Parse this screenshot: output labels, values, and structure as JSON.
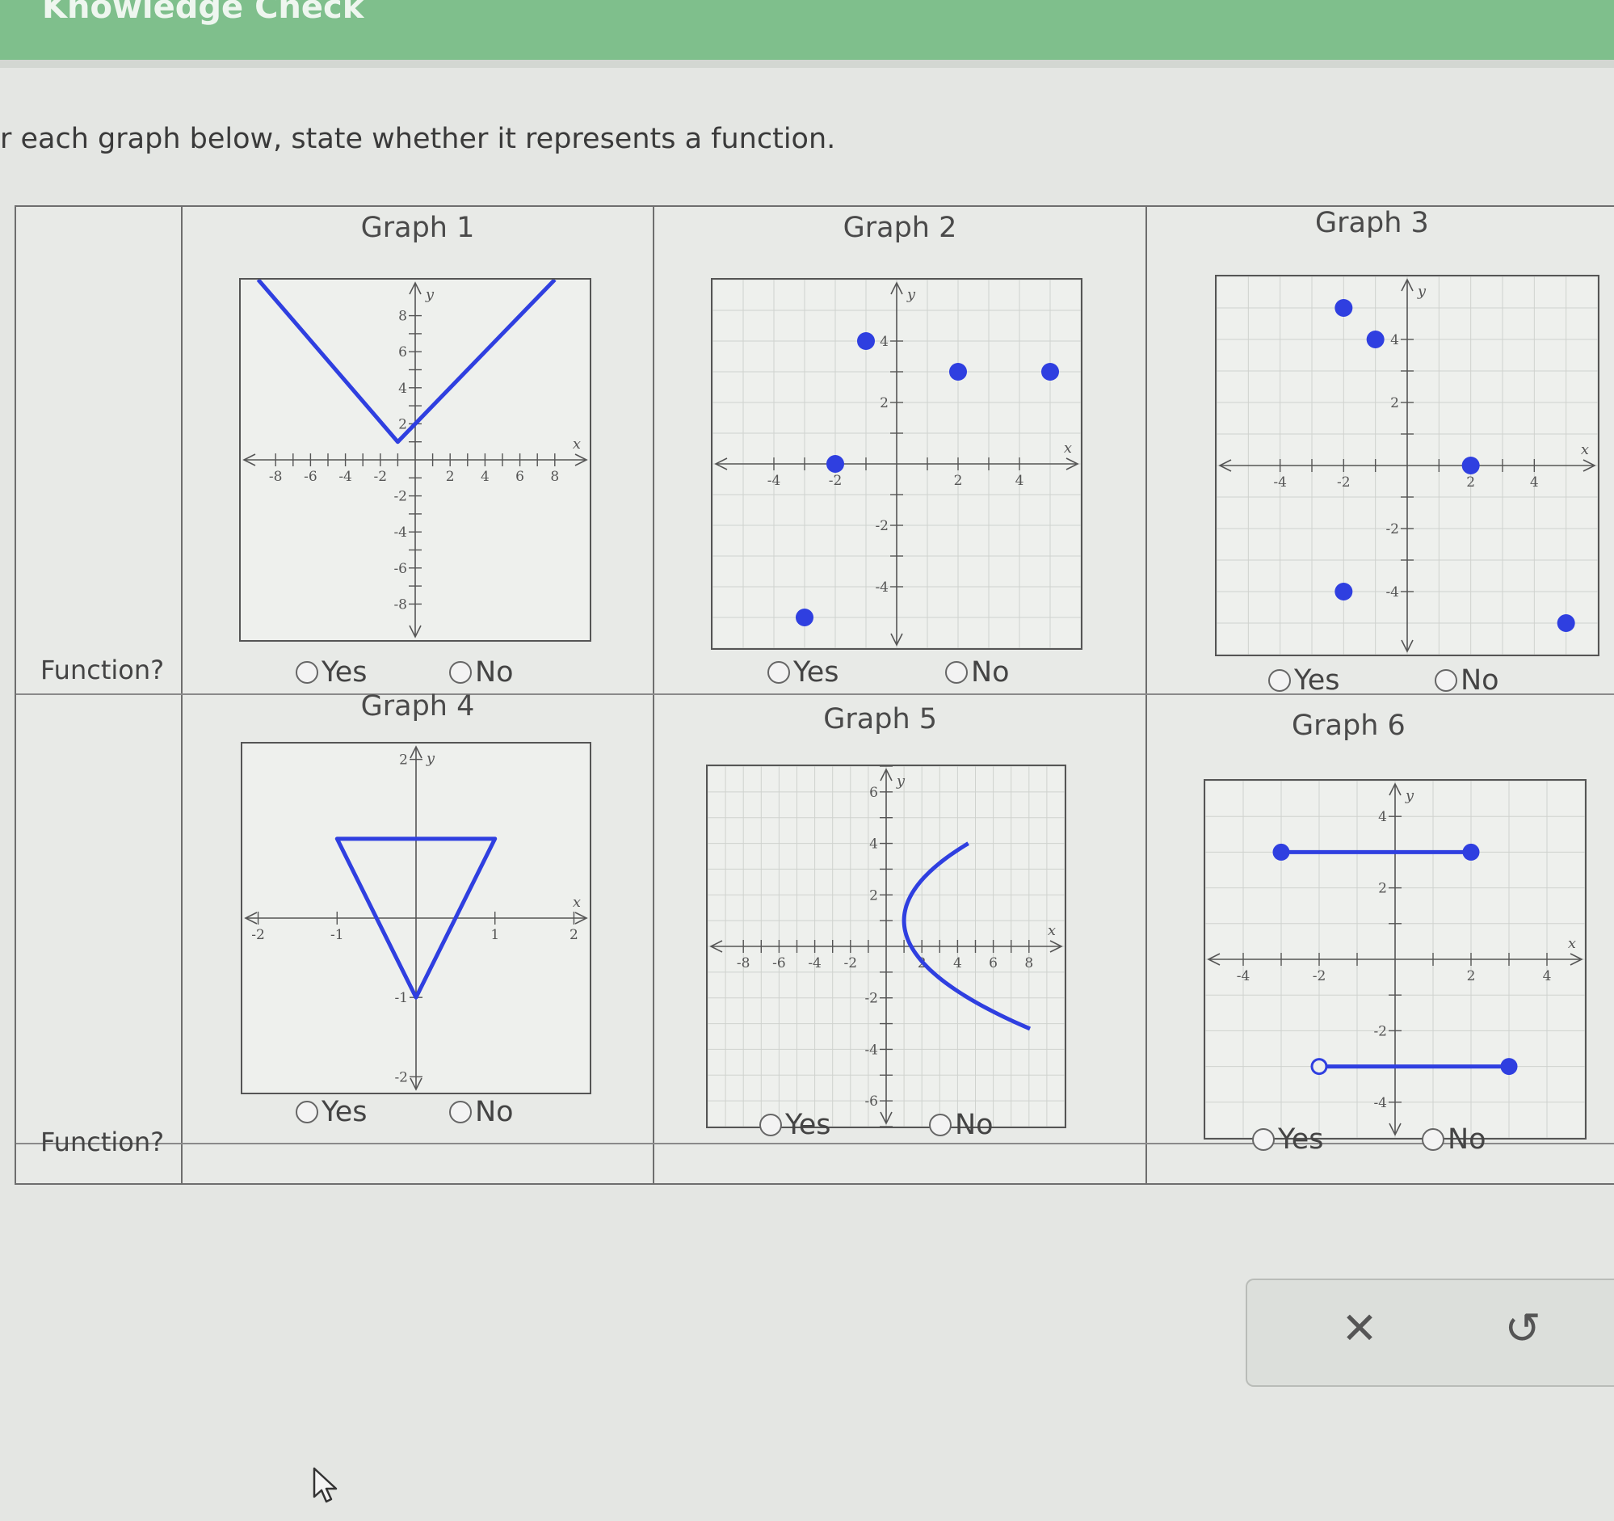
{
  "header": {
    "title": "Knowledge Check"
  },
  "instruction": "r each graph below, state whether it represents a function.",
  "row_label": "Function?",
  "options": {
    "yes": "Yes",
    "no": "No"
  },
  "graphs": [
    {
      "title": "Graph 1",
      "xlim": [
        -10,
        10
      ],
      "ylim": [
        -10,
        10
      ],
      "xticks": [
        -8,
        -6,
        -4,
        -2,
        2,
        4,
        6,
        8
      ],
      "yticks": [
        -8,
        -6,
        -4,
        -2,
        2,
        4,
        6,
        8
      ],
      "tick_marks": [
        -8,
        -7,
        -6,
        -5,
        -4,
        -3,
        -2,
        -1,
        1,
        2,
        3,
        4,
        5,
        6,
        7,
        8
      ],
      "grid": false,
      "shape": {
        "kind": "polyline",
        "points": [
          [
            -9,
            10
          ],
          [
            -1,
            1
          ],
          [
            8,
            10
          ]
        ]
      }
    },
    {
      "title": "Graph 2",
      "xlim": [
        -6,
        6
      ],
      "ylim": [
        -6,
        6
      ],
      "xticks": [
        -4,
        -2,
        2,
        4
      ],
      "yticks": [
        -4,
        -2,
        2,
        4
      ],
      "tick_marks": [
        -4,
        -3,
        -2,
        -1,
        1,
        2,
        3,
        4
      ],
      "grid": true,
      "shape": {
        "kind": "points",
        "points": [
          [
            -2,
            0
          ],
          [
            -1,
            4
          ],
          [
            2,
            3
          ],
          [
            5,
            3
          ],
          [
            -3,
            -5
          ]
        ]
      }
    },
    {
      "title": "Graph 3",
      "xlim": [
        -6,
        6
      ],
      "ylim": [
        -6,
        6
      ],
      "xticks": [
        -4,
        -2,
        2,
        4
      ],
      "yticks": [
        -4,
        -2,
        2,
        4
      ],
      "tick_marks": [
        -4,
        -3,
        -2,
        -1,
        1,
        2,
        3,
        4
      ],
      "grid": true,
      "shape": {
        "kind": "points",
        "points": [
          [
            -2,
            5
          ],
          [
            -1,
            4
          ],
          [
            2,
            0
          ],
          [
            -2,
            -4
          ],
          [
            5,
            -5
          ]
        ]
      }
    },
    {
      "title": "Graph 4",
      "xlim": [
        -2.2,
        2.2
      ],
      "ylim": [
        -2.2,
        2.2
      ],
      "xticks": [
        -2,
        -1,
        1,
        2
      ],
      "yticks": [
        -2,
        -1,
        2
      ],
      "tick_marks": [
        -2,
        -1,
        1,
        2
      ],
      "grid": false,
      "shape": {
        "kind": "polygon",
        "points": [
          [
            -1,
            1
          ],
          [
            1,
            1
          ],
          [
            0,
            -1
          ]
        ]
      }
    },
    {
      "title": "Graph 5",
      "xlim": [
        -10,
        10
      ],
      "ylim": [
        -7,
        7
      ],
      "xticks": [
        -8,
        -6,
        -4,
        -2,
        2,
        4,
        6,
        8
      ],
      "yticks": [
        -6,
        -4,
        -2,
        2,
        4,
        6
      ],
      "tick_marks": [
        -8,
        -7,
        -6,
        -5,
        -4,
        -3,
        -2,
        -1,
        1,
        2,
        3,
        4,
        5,
        6,
        7,
        8
      ],
      "grid": true,
      "shape": {
        "kind": "parabola_x",
        "vertex": [
          1,
          1
        ],
        "a": 0.4,
        "ymin": -3.2,
        "ymax": 4
      }
    },
    {
      "title": "Graph 6",
      "xlim": [
        -5,
        5
      ],
      "ylim": [
        -5,
        5
      ],
      "xticks": [
        -4,
        -2,
        2,
        4
      ],
      "yticks": [
        -4,
        -2,
        2,
        4
      ],
      "tick_marks": [
        -4,
        -3,
        -2,
        -1,
        1,
        2,
        3,
        4
      ],
      "grid": true,
      "shape": {
        "kind": "segments",
        "segments": [
          {
            "from": [
              -3,
              3
            ],
            "to": [
              2,
              3
            ],
            "from_open": false,
            "to_open": false
          },
          {
            "from": [
              -2,
              -3
            ],
            "to": [
              3,
              -3
            ],
            "from_open": true,
            "to_open": false
          }
        ]
      }
    }
  ],
  "actions": {
    "clear": "✕",
    "undo": "↺"
  },
  "colors": {
    "curve": "#2f3fe0",
    "axis": "#555555",
    "grid": "#cfd2ce"
  },
  "icons": {
    "clear": "close-icon",
    "undo": "undo-icon",
    "cursor": "mouse-pointer-icon"
  }
}
